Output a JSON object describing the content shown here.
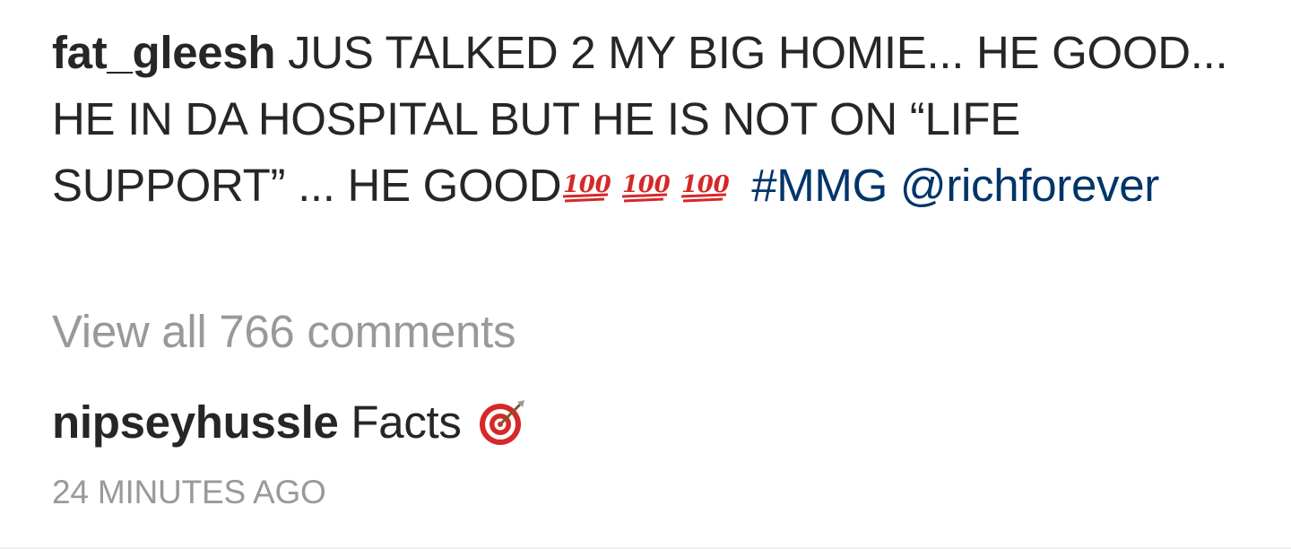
{
  "post": {
    "author": "fat_gleesh",
    "caption_text": "JUS TALKED 2 MY BIG HOMIE... HE GOOD... HE IN DA HOSPITAL BUT HE IS NOT ON “LIFE SUPPORT” ... HE GOOD",
    "emojis": [
      "hundred-points-icon",
      "hundred-points-icon",
      "hundred-points-icon"
    ],
    "hashtag": "#MMG",
    "mention": "@richforever",
    "link_color": "#003569"
  },
  "comments": {
    "view_all_label": "View all 766 comments",
    "items": [
      {
        "author": "nipseyhussle",
        "text": "Facts",
        "emoji": "direct-hit-target-icon"
      }
    ]
  },
  "timestamp": "24 MINUTES AGO"
}
